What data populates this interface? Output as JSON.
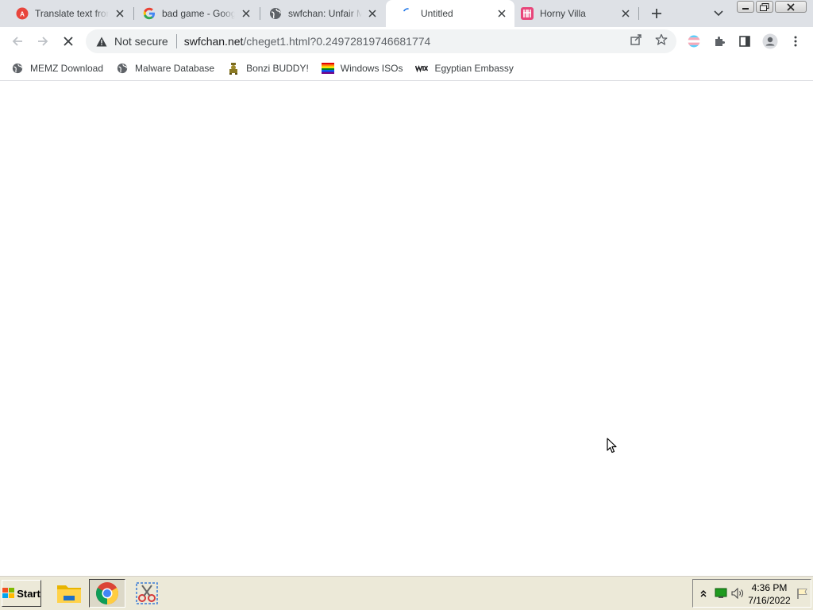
{
  "browser": {
    "tabs": [
      {
        "title": "Translate text from",
        "favicon": "translate-favicon",
        "active": false
      },
      {
        "title": "bad game - Goog",
        "favicon": "google-favicon",
        "active": false
      },
      {
        "title": "swfchan: Unfair M",
        "favicon": "globe-favicon",
        "active": false
      },
      {
        "title": "Untitled",
        "favicon": "loading-favicon",
        "active": true
      },
      {
        "title": "Horny Villa",
        "favicon": "villa-favicon",
        "active": false
      }
    ],
    "omnibox": {
      "security_label": "Not secure",
      "domain": "swfchan.net",
      "path": "/cheget1.html?0.24972819746681774"
    }
  },
  "bookmarks": [
    {
      "label": "MEMZ Download",
      "icon": "globe-icon"
    },
    {
      "label": "Malware Database",
      "icon": "globe-icon"
    },
    {
      "label": "Bonzi BUDDY!",
      "icon": "bonzi-icon"
    },
    {
      "label": "Windows ISOs",
      "icon": "rainbow-flag-icon"
    },
    {
      "label": "Egyptian Embassy",
      "icon": "wix-icon"
    }
  ],
  "taskbar": {
    "start_label": "Start",
    "apps": [
      "file-explorer-icon",
      "chrome-icon",
      "snipping-tool-icon"
    ],
    "clock_time": "4:36 PM",
    "clock_date": "7/16/2022"
  },
  "colors": {
    "tabstrip_bg": "#dee1e6",
    "omnibox_bg": "#f1f3f4",
    "taskbar_bg": "#ece9d8"
  }
}
